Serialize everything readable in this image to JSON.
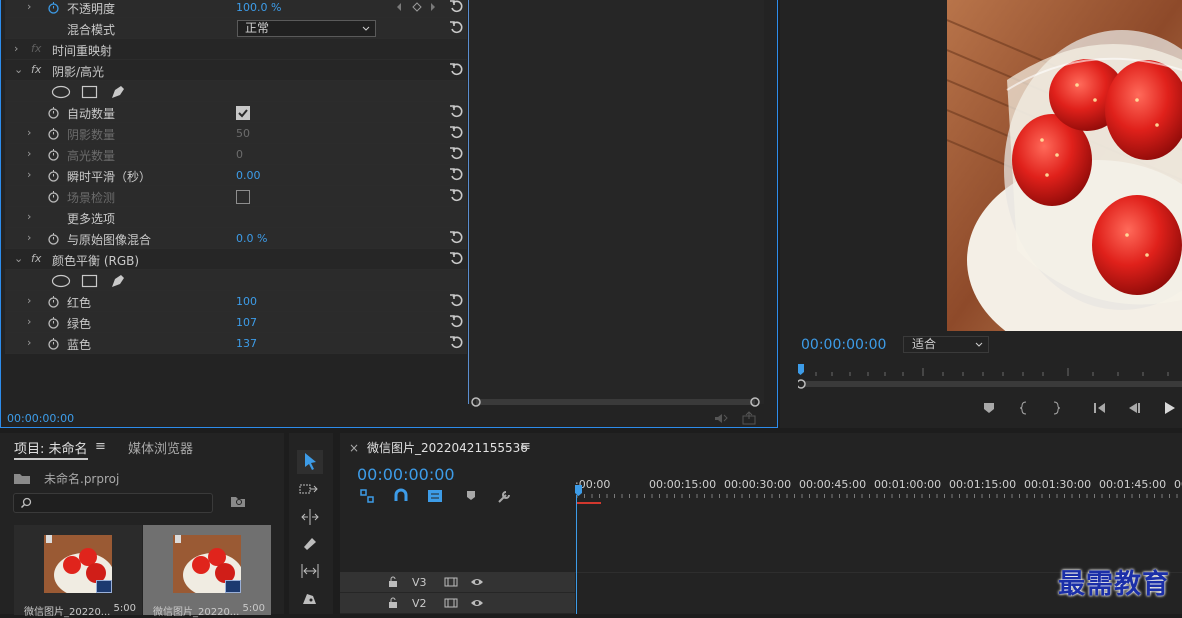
{
  "effect_controls": {
    "rows": [
      {
        "type": "param",
        "label": "不透明度",
        "value": "100.0 %",
        "has_stopwatch": true,
        "active_stopwatch": true,
        "has_chevron": true,
        "keyframes": true
      },
      {
        "type": "select",
        "label": "混合模式",
        "value": "正常"
      },
      {
        "type": "section",
        "label": "时间重映射",
        "fx_dim": true
      },
      {
        "type": "section",
        "label": "阴影/高光",
        "expanded": true,
        "has_reset": true
      },
      {
        "type": "shapes"
      },
      {
        "type": "checkbox",
        "label": "自动数量",
        "checked": true,
        "has_stopwatch": true
      },
      {
        "type": "param",
        "label": "阴影数量",
        "value": "50",
        "dim": true,
        "has_stopwatch": true,
        "has_chevron": true
      },
      {
        "type": "param",
        "label": "高光数量",
        "value": "0",
        "dim": true,
        "has_stopwatch": true,
        "has_chevron": true
      },
      {
        "type": "param",
        "label": "瞬时平滑（秒）",
        "value": "0.00",
        "has_stopwatch": true,
        "has_chevron": true
      },
      {
        "type": "checkbox",
        "label": "场景检测",
        "checked": false,
        "dim": true,
        "has_stopwatch": true
      },
      {
        "type": "param",
        "label": "更多选项",
        "value": "",
        "has_chevron": true,
        "no_reset": true
      },
      {
        "type": "param",
        "label": "与原始图像混合",
        "value": "0.0 %",
        "has_stopwatch": true,
        "has_chevron": true
      },
      {
        "type": "section",
        "label": "颜色平衡 (RGB)",
        "expanded": true,
        "has_reset": true
      },
      {
        "type": "shapes"
      },
      {
        "type": "param",
        "label": "红色",
        "value": "100",
        "has_stopwatch": true,
        "has_chevron": true
      },
      {
        "type": "param",
        "label": "绿色",
        "value": "107",
        "has_stopwatch": true,
        "has_chevron": true
      },
      {
        "type": "param",
        "label": "蓝色",
        "value": "137",
        "has_stopwatch": true,
        "has_chevron": true
      }
    ],
    "footer_timecode": "00:00:00:00"
  },
  "program_monitor": {
    "timecode": "00:00:00:00",
    "fit_label": "适合"
  },
  "project_panel": {
    "tab_label": "项目: 未命名",
    "menu_icon": "≡",
    "media_tab_label": "媒体浏览器",
    "file_name": "未命名.prproj",
    "items": [
      {
        "label": "微信图片_20220...",
        "duration": "5:00",
        "selected": false
      },
      {
        "label": "微信图片_20220...",
        "duration": "5:00",
        "selected": true
      }
    ]
  },
  "timeline": {
    "close_label": "×",
    "sequence_name": "微信图片_20220421155536",
    "menu_icon": "≡",
    "timecode": "00:00:00:00",
    "ruler_labels": [
      ":00:00",
      "00:00:15:00",
      "00:00:30:00",
      "00:00:45:00",
      "00:01:00:00",
      "00:01:15:00",
      "00:01:30:00",
      "00:01:45:00",
      "00:02:0"
    ],
    "tracks": [
      "V3",
      "V2"
    ]
  },
  "watermark": "最需教育",
  "colors": {
    "accent": "#3d9ce8",
    "panel_bg": "#232323",
    "row_bg": "#2b2b2b",
    "watermark": "#1b2fa8"
  }
}
